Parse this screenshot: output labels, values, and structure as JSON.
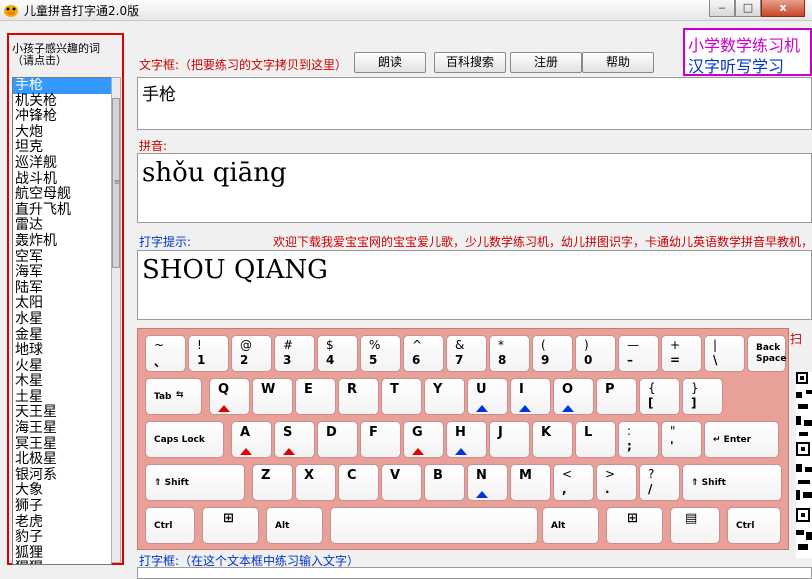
{
  "window": {
    "title": "儿童拼音打字通2.0版",
    "minimize_label": "‒",
    "maximize_label": "□",
    "close_label": "x"
  },
  "left": {
    "header": "小孩子感兴趣的词（请点击）",
    "words": [
      "手枪",
      "机关枪",
      "冲锋枪",
      "大炮",
      "坦克",
      "巡洋舰",
      "战斗机",
      "航空母舰",
      "直升飞机",
      "雷达",
      "轰炸机",
      "空军",
      "海军",
      "陆军",
      "太阳",
      "水星",
      "金星",
      "地球",
      "火星",
      "木星",
      "土星",
      "天王星",
      "海王星",
      "冥王星",
      "北极星",
      "银河系",
      "大象",
      "狮子",
      "老虎",
      "豹子",
      "狐狸",
      "猩猩"
    ],
    "selected_index": 0
  },
  "toolbar": {
    "text_label": "文字框:（把要练习的文字拷贝到这里）",
    "read_button": "朗读",
    "baike_button": "百科搜索",
    "register_button": "注册",
    "help_button": "帮助"
  },
  "promo": {
    "line1": "小学数学练习机",
    "line2": "汉字听写学习",
    "line1_color": "#cc00cc",
    "line2_color": "#0033cc"
  },
  "text_box": {
    "value": "手枪"
  },
  "pinyin": {
    "label": "拼音:",
    "value": "shǒu qiāng"
  },
  "hint": {
    "label": "打字提示:",
    "scroll_text": "欢迎下载我爱宝宝网的宝宝爱儿歌，少儿数学练习机，幼儿拼图识字，卡通幼儿英语数学拼音早教机，",
    "value": "SHOU QIANG"
  },
  "input": {
    "label": "打字框:（在这个文本框中练习输入文字）"
  },
  "side_label": "扫",
  "keyboard": {
    "row1": [
      {
        "top": "~",
        "bot": "、"
      },
      {
        "top": "!",
        "bot": "1"
      },
      {
        "top": "@",
        "bot": "2"
      },
      {
        "top": "#",
        "bot": "3"
      },
      {
        "top": "$",
        "bot": "4"
      },
      {
        "top": "%",
        "bot": "5"
      },
      {
        "top": "^",
        "bot": "6"
      },
      {
        "top": "&",
        "bot": "7"
      },
      {
        "top": "*",
        "bot": "8"
      },
      {
        "top": "(",
        "bot": "9"
      },
      {
        "top": ")",
        "bot": "0"
      },
      {
        "top": "—",
        "bot": "–"
      },
      {
        "top": "+",
        "bot": "="
      },
      {
        "top": "|",
        "bot": "\\"
      },
      {
        "top": "Back",
        "bot": "Space"
      }
    ],
    "tab_label": "Tab",
    "row2": [
      {
        "k": "Q",
        "m": "red"
      },
      {
        "k": "W",
        "m": ""
      },
      {
        "k": "E",
        "m": ""
      },
      {
        "k": "R",
        "m": ""
      },
      {
        "k": "T",
        "m": ""
      },
      {
        "k": "Y",
        "m": ""
      },
      {
        "k": "U",
        "m": "blue"
      },
      {
        "k": "I",
        "m": "blue"
      },
      {
        "k": "O",
        "m": "blue"
      },
      {
        "k": "P",
        "m": ""
      },
      {
        "k": "{",
        "k2": "[",
        "m": ""
      },
      {
        "k": "}",
        "k2": "]",
        "m": ""
      }
    ],
    "caps_label": "Caps Lock",
    "row3": [
      {
        "k": "A",
        "m": "red"
      },
      {
        "k": "S",
        "m": "red"
      },
      {
        "k": "D",
        "m": ""
      },
      {
        "k": "F",
        "m": ""
      },
      {
        "k": "G",
        "m": "red"
      },
      {
        "k": "H",
        "m": "blue"
      },
      {
        "k": "J",
        "m": ""
      },
      {
        "k": "K",
        "m": ""
      },
      {
        "k": "L",
        "m": ""
      },
      {
        "k": ":",
        "k2": ";",
        "m": ""
      },
      {
        "k": "\"",
        "k2": "'",
        "m": ""
      }
    ],
    "enter_label": "↵ Enter",
    "shift_label": "⇑ Shift",
    "row4": [
      {
        "k": "Z",
        "m": ""
      },
      {
        "k": "X",
        "m": ""
      },
      {
        "k": "C",
        "m": ""
      },
      {
        "k": "V",
        "m": ""
      },
      {
        "k": "B",
        "m": ""
      },
      {
        "k": "N",
        "m": "blue"
      },
      {
        "k": "M",
        "m": ""
      },
      {
        "k": "<",
        "k2": ",",
        "m": ""
      },
      {
        "k": ">",
        "k2": ".",
        "m": ""
      },
      {
        "k": "?",
        "k2": "/",
        "m": ""
      }
    ],
    "ctrl_label": "Ctrl",
    "alt_label": "Alt",
    "win_label": "⊞",
    "menu_label": "▤"
  }
}
